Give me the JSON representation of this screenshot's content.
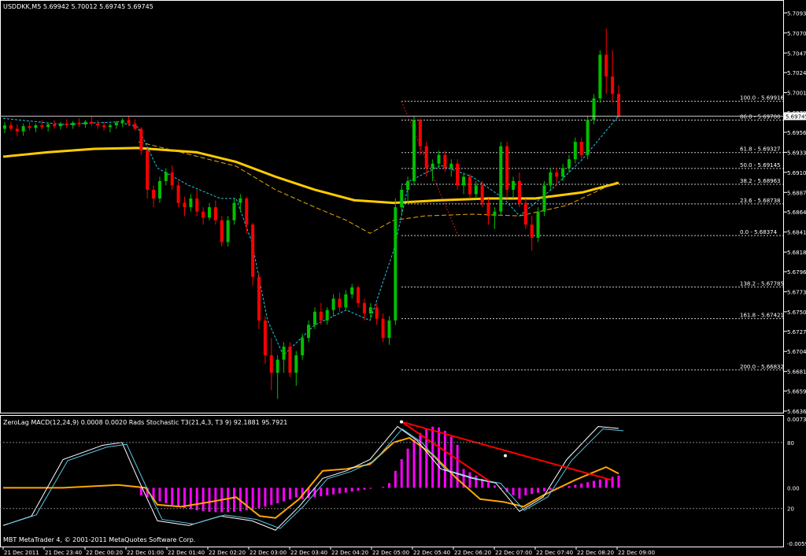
{
  "header": {
    "symbol_info": "USDDKK,M5  5.69942 5.70012 5.69745 5.69745",
    "indicator_info": "ZeroLag MACD(12,24,9) 0.0008 0.0020  Rads Stochastic T3(21,4,3, T3 9) 92.1881 95.7921",
    "copyright": "MBT MetaTrader 4, © 2001-2011 MetaQuotes Software Corp."
  },
  "colors": {
    "background": "#000000",
    "bull_candle": "#00c000",
    "bear_candle": "#ff0000",
    "ma_long": "#ffcc00",
    "ma_dashed": "#e6a800",
    "bollinger": "#1ec8e6",
    "fib_dotted": "#c81e1e",
    "fib_levels": "#c8c8c8",
    "histogram": "#ff00ff",
    "stoch_white": "#ffffff",
    "stoch_cyan": "#5ac8e6",
    "signal_orange": "#ffa500",
    "trendline": "#ff0000"
  },
  "chart_data": [
    {
      "type": "candlestick",
      "symbol": "USDDKK",
      "timeframe": "M5",
      "price_axis_labels": [
        "5.70930",
        "5.70700",
        "5.70470",
        "5.70245",
        "5.70015",
        "5.69785",
        "5.69560",
        "5.69330",
        "5.69100",
        "5.68870",
        "5.68645",
        "5.68415",
        "5.68185",
        "5.67960",
        "5.67730",
        "5.67500",
        "5.67275",
        "5.67045",
        "5.66815",
        "5.66590",
        "5.66360"
      ],
      "price_range": [
        5.6636,
        5.7106
      ],
      "current_price_label": "5.69745",
      "current_price": 5.69745,
      "fib_levels": [
        {
          "label": "100.0 - 5.69916",
          "price": 5.69916
        },
        {
          "label": "86.0 - 5.69700",
          "price": 5.697
        },
        {
          "label": "61.8 - 5.69327",
          "price": 5.69327
        },
        {
          "label": "50.0 - 5.69145",
          "price": 5.69145
        },
        {
          "label": "38.2 - 5.68963",
          "price": 5.68963
        },
        {
          "label": "23.6 - 5.68738",
          "price": 5.68738
        },
        {
          "label": "0.0 - 5.68374",
          "price": 5.68374
        },
        {
          "label": "138.2 - 5.67785",
          "price": 5.67785
        },
        {
          "label": "161.8 - 5.67421",
          "price": 5.67421
        },
        {
          "label": "200.0 - 5.66832",
          "price": 5.66832
        }
      ],
      "time_axis_labels": [
        "21 Dec 2011",
        "21 Dec 23:40",
        "22 Dec 00:20",
        "22 Dec 01:00",
        "22 Dec 01:40",
        "22 Dec 02:20",
        "22 Dec 03:00",
        "22 Dec 03:40",
        "22 Dec 04:20",
        "22 Dec 05:00",
        "22 Dec 05:40",
        "22 Dec 06:20",
        "22 Dec 07:00",
        "22 Dec 07:40",
        "22 Dec 08:20",
        "22 Dec 09:00"
      ],
      "grid": false
    },
    {
      "type": "indicator",
      "name": "ZeroLag MACD(12,24,9) / Rads Stochastic T3",
      "axis_labels": [
        "0.0073",
        "80",
        "0.00",
        "20",
        "-0.0059"
      ],
      "axis_range": [
        -0.0059,
        0.0073
      ]
    }
  ]
}
